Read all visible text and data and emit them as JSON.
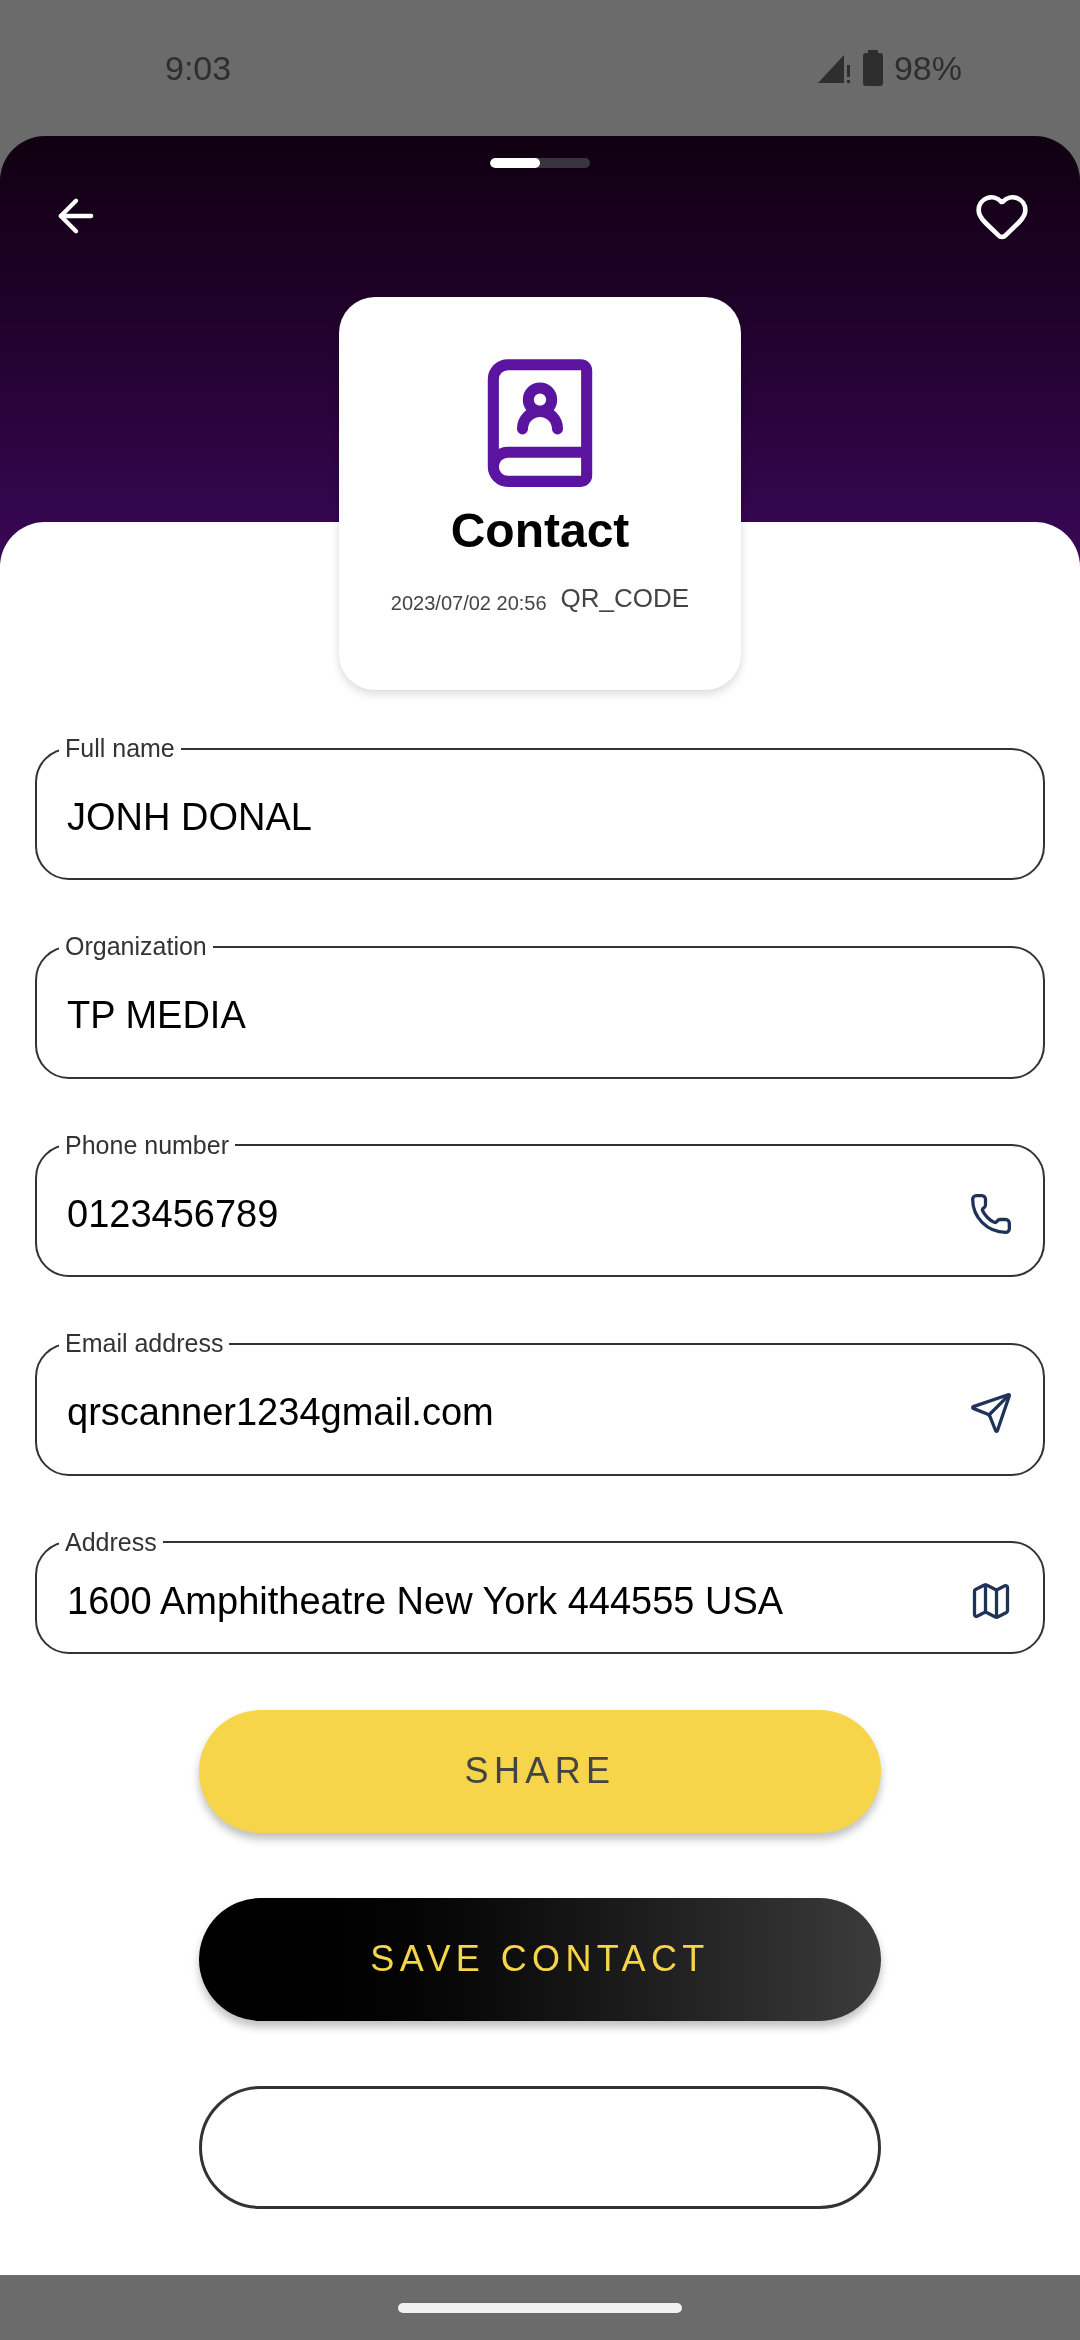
{
  "status_bar": {
    "time": "9:03",
    "battery": "98%"
  },
  "header": {
    "page_indicator": {
      "level": 0.5
    }
  },
  "card": {
    "title": "Contact",
    "date": "2023/07/02 20:56",
    "format": "QR_CODE"
  },
  "fields": [
    {
      "label": "Full name",
      "value": "JONH DONAL",
      "kind": "text"
    },
    {
      "label": "Organization",
      "value": "TP MEDIA",
      "kind": "text"
    },
    {
      "label": "Phone number",
      "value": "0123456789",
      "kind": "phone"
    },
    {
      "label": "Email address",
      "value": "qrscanner1234gmail.com",
      "kind": "email"
    },
    {
      "label": "Address",
      "value": "1600 Amphitheatre New York  444555 USA",
      "kind": "address"
    }
  ],
  "buttons": [
    {
      "label": "SHARE",
      "kind": "primary"
    },
    {
      "label": "SAVE CONTACT",
      "kind": "dark"
    },
    {
      "kind": "outline"
    }
  ]
}
